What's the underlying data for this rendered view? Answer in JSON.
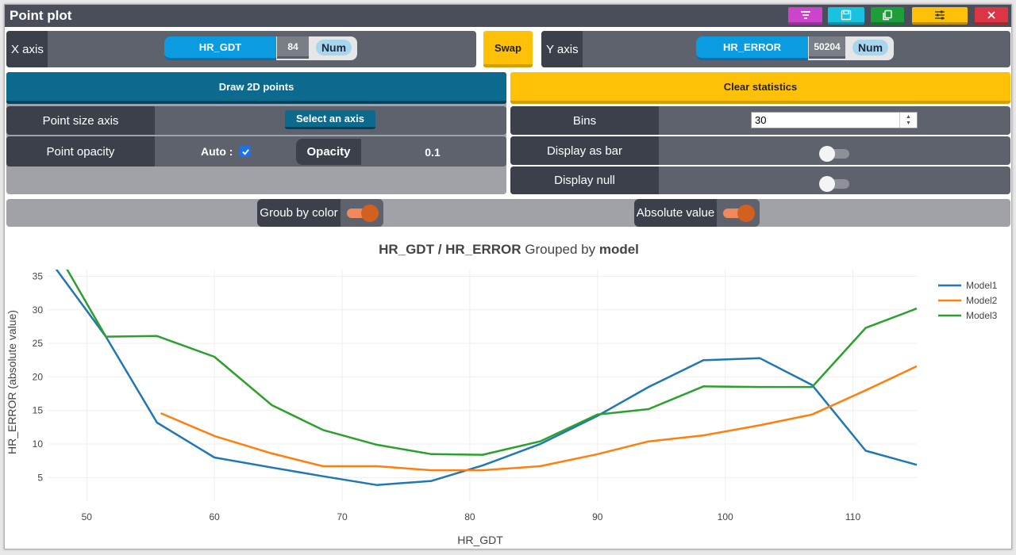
{
  "window": {
    "title": "Point plot",
    "buttons": [
      {
        "name": "filter-button",
        "icon": "filter-icon",
        "color": "#cc44cc"
      },
      {
        "name": "save-button",
        "icon": "save-icon",
        "color": "#17c3e0"
      },
      {
        "name": "copy-button",
        "icon": "copy-icon",
        "color": "#1e9e3a"
      },
      {
        "name": "settings-button",
        "icon": "sliders-icon",
        "color": "#ffc107"
      },
      {
        "name": "close-button",
        "icon": "close-icon",
        "color": "#dc3545"
      }
    ]
  },
  "axes_bar": {
    "x_label": "X axis",
    "x_field": "HR_GDT",
    "x_count": "84",
    "x_type": "Num",
    "swap_label": "Swap",
    "y_label": "Y axis",
    "y_field": "HR_ERROR",
    "y_count": "50204",
    "y_type": "Num"
  },
  "left_panel": {
    "draw_button": "Draw 2D points",
    "point_size_label": "Point size axis",
    "select_axis_button": "Select an axis",
    "point_opacity_label": "Point opacity",
    "auto_label": "Auto :",
    "auto_checked": true,
    "opacity_label": "Opacity",
    "opacity_value": "0.1"
  },
  "right_panel": {
    "clear_button": "Clear statistics",
    "bins_label": "Bins",
    "bins_value": "30",
    "display_bar_label": "Display as bar",
    "display_bar_on": false,
    "display_null_label": "Display null",
    "display_null_on": false
  },
  "toggles_row": {
    "group_label": "Groub by color",
    "group_on": true,
    "absolute_label": "Absolute value",
    "absolute_on": true
  },
  "colors": {
    "accent_blue": "#0a9be0",
    "accent_yellow": "#ffc107",
    "dark_teal": "#0b6a8e",
    "toggle_orange": "#d2601f"
  },
  "chart_data": {
    "type": "line",
    "title_parts": [
      "HR_GDT",
      " / ",
      "HR_ERROR",
      " Grouped by ",
      "model"
    ],
    "xlabel": "HR_GDT",
    "ylabel": "HR_ERROR (absolute value)",
    "xlim": [
      47,
      115
    ],
    "ylim": [
      1.5,
      36
    ],
    "xticks": [
      50,
      60,
      70,
      80,
      90,
      100,
      110
    ],
    "yticks": [
      5,
      10,
      15,
      20,
      25,
      30,
      35
    ],
    "grid": true,
    "legend": "top-right",
    "series": [
      {
        "name": "Model1",
        "color": "#1f77b4",
        "x": [
          45.5,
          51.5,
          55.5,
          60,
          64.5,
          68.5,
          72.7,
          77,
          81,
          85.5,
          90,
          94,
          98.3,
          102.7,
          106.8,
          111,
          115
        ],
        "y": [
          41.5,
          26,
          13.2,
          8,
          6.5,
          5.2,
          3.9,
          4.5,
          6.8,
          10,
          14.2,
          18.5,
          22.5,
          22.8,
          18.8,
          9,
          6.9
        ]
      },
      {
        "name": "Model2",
        "color": "#ff7f0e",
        "x": [
          55.8,
          60,
          64.5,
          68.5,
          72.7,
          77,
          81,
          85.5,
          90,
          94,
          98.3,
          102.7,
          106.8,
          111,
          115
        ],
        "y": [
          14.6,
          11.2,
          8.6,
          6.7,
          6.7,
          6.1,
          6.1,
          6.7,
          8.5,
          10.4,
          11.3,
          12.8,
          14.4,
          18,
          21.6
        ]
      },
      {
        "name": "Model3",
        "color": "#2ca02c",
        "x": [
          46.5,
          51.5,
          55.5,
          60,
          64.5,
          68.5,
          72.7,
          77,
          81,
          85.5,
          90,
          94,
          98.3,
          102.7,
          106.8,
          111,
          115
        ],
        "y": [
          42.5,
          26,
          26.1,
          23,
          15.8,
          12.1,
          9.9,
          8.5,
          8.4,
          10.4,
          14.4,
          15.2,
          18.6,
          18.5,
          18.5,
          27.3,
          30.2
        ]
      }
    ]
  }
}
